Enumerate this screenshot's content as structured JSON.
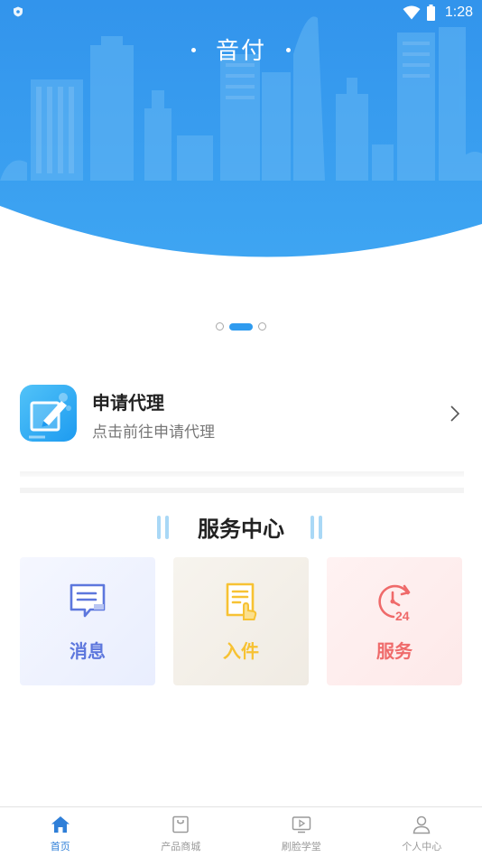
{
  "status_bar": {
    "time": "1:28"
  },
  "header": {
    "title": "音付"
  },
  "banner": {
    "pages": 3,
    "active_index": 1
  },
  "apply": {
    "title": "申请代理",
    "subtitle": "点击前往申请代理"
  },
  "service_center": {
    "title": "服务中心",
    "items": [
      {
        "label": "消息",
        "icon": "message-icon",
        "color": "#5d77dd"
      },
      {
        "label": "入件",
        "icon": "document-hand-icon",
        "color": "#f7c233"
      },
      {
        "label": "服务",
        "icon": "clock-24-icon",
        "color": "#ef6a6a"
      }
    ]
  },
  "tabbar": {
    "items": [
      {
        "label": "首页",
        "icon": "home-icon",
        "active": true
      },
      {
        "label": "产品商城",
        "icon": "shop-icon",
        "active": false
      },
      {
        "label": "刷脸学堂",
        "icon": "video-icon",
        "active": false
      },
      {
        "label": "个人中心",
        "icon": "user-icon",
        "active": false
      }
    ]
  },
  "colors": {
    "primary": "#2f9bef",
    "header_blue": "#3596ee",
    "tab_active": "#2f7fd8"
  }
}
